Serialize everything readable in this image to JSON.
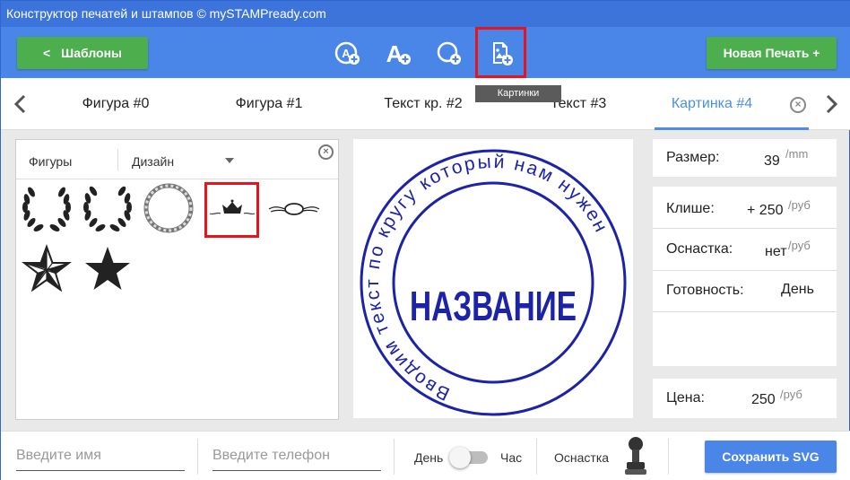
{
  "window": {
    "title": "Конструктор печатей и штампов © mySTAMPready.com"
  },
  "toolbar": {
    "templates_label": "Шаблоны",
    "templates_chevron": "<",
    "new_stamp_label": "Новая Печать +",
    "tools": [
      "add-circle-text-icon",
      "add-text-icon",
      "add-shape-icon",
      "add-image-icon"
    ],
    "tooltip": "Картинки"
  },
  "tabs": [
    {
      "label": "Фигура #0"
    },
    {
      "label": "Фигура #1"
    },
    {
      "label": "Текст кр. #2"
    },
    {
      "label": "Текст #3"
    },
    {
      "label": "Картинка #4",
      "active": true
    }
  ],
  "library": {
    "tab_figures": "Фигуры",
    "tab_design": "Дизайн",
    "items": [
      "laurel-wreath",
      "laurel-wreath-2",
      "rope-circle",
      "crown-ornament",
      "oval-ornament",
      "star-outline",
      "star-filled"
    ]
  },
  "stamp": {
    "circle_text": "Вводим текст по кругу который нам нужен",
    "center_text": "НАЗВАНИЕ",
    "color": "#1c23a8"
  },
  "info": {
    "size_label": "Размер:",
    "size_value": "39",
    "size_unit": "/mm",
    "cliche_label": "Клише:",
    "cliche_value": "+ 250",
    "cliche_unit": "/руб",
    "rig_label": "Оснастка:",
    "rig_value": "нет",
    "rig_unit": "/руб",
    "ready_label": "Готовность:",
    "ready_value": "День",
    "price_label": "Цена:",
    "price_value": "250",
    "price_unit": "/руб"
  },
  "footer": {
    "name_placeholder": "Введите имя",
    "phone_placeholder": "Введите телефон",
    "day_label": "День",
    "hour_label": "Час",
    "rig_label": "Оснастка",
    "save_label": "Сохранить SVG"
  },
  "colors": {
    "accent": "#4a86e8",
    "green": "#4cae4c",
    "highlight": "#e8141b",
    "active_tab": "#4a90e2"
  }
}
